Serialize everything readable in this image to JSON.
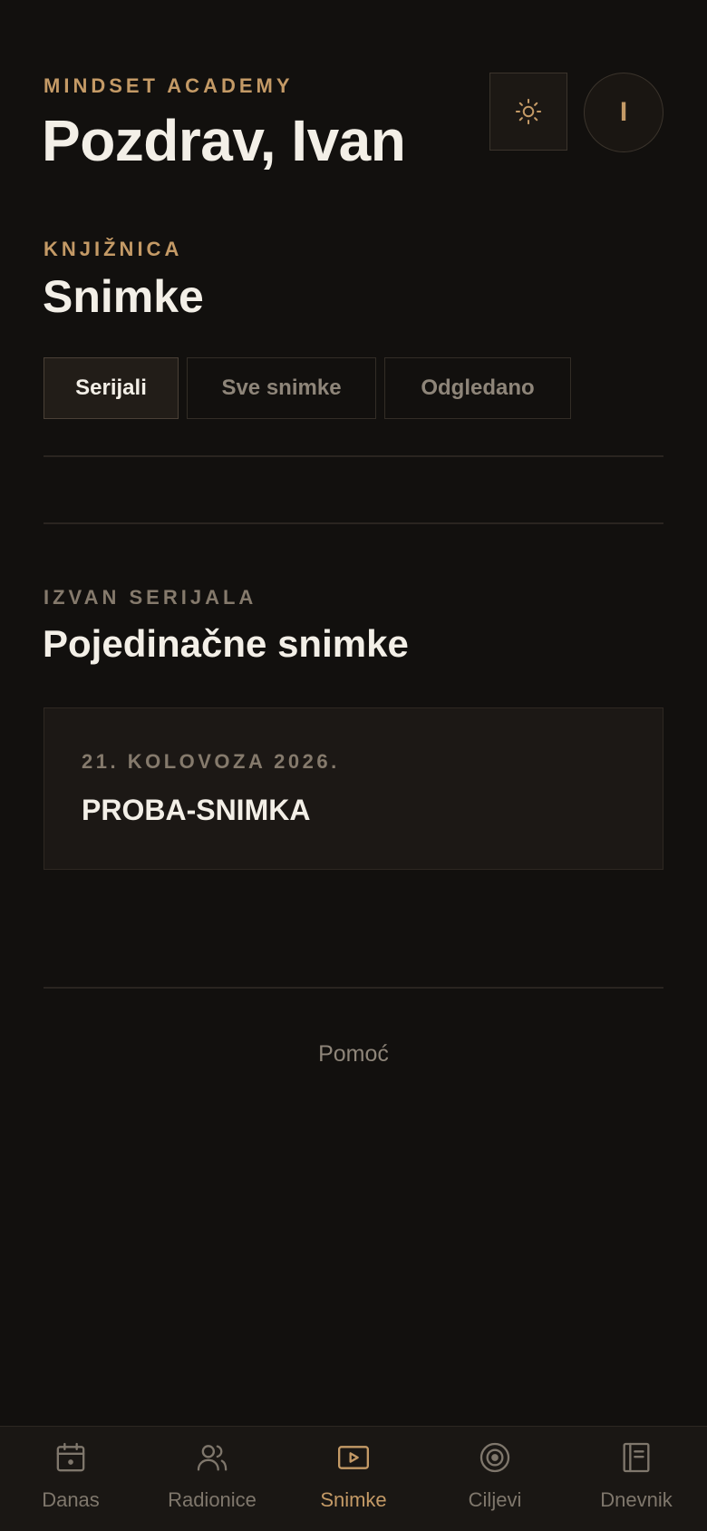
{
  "header": {
    "brand": "MINDSET ACADEMY",
    "greeting": "Pozdrav, Ivan",
    "theme_toggle_icon": "sun-icon",
    "avatar_initial": "I"
  },
  "library": {
    "eyebrow": "KNJIŽNICA",
    "title": "Snimke",
    "tabs": [
      {
        "label": "Serijali",
        "active": true
      },
      {
        "label": "Sve snimke",
        "active": false
      },
      {
        "label": "Odgledano",
        "active": false
      }
    ]
  },
  "standalone": {
    "eyebrow": "IZVAN SERIJALA",
    "title": "Pojedinačne snimke",
    "recordings": [
      {
        "date": "21. KOLOVOZA 2026.",
        "title": "PROBA-SNIMKA"
      }
    ]
  },
  "footer": {
    "help_link": "Pomoć"
  },
  "bottom_nav": {
    "items": [
      {
        "label": "Danas",
        "icon": "calendar-icon",
        "active": false
      },
      {
        "label": "Radionice",
        "icon": "users-icon",
        "active": false
      },
      {
        "label": "Snimke",
        "icon": "video-play-icon",
        "active": true
      },
      {
        "label": "Ciljevi",
        "icon": "target-icon",
        "active": false
      },
      {
        "label": "Dnevnik",
        "icon": "notebook-icon",
        "active": false
      }
    ]
  },
  "colors": {
    "background": "#12100e",
    "accent": "#c49a66",
    "text": "#f3efe7",
    "muted": "#857a6c"
  }
}
